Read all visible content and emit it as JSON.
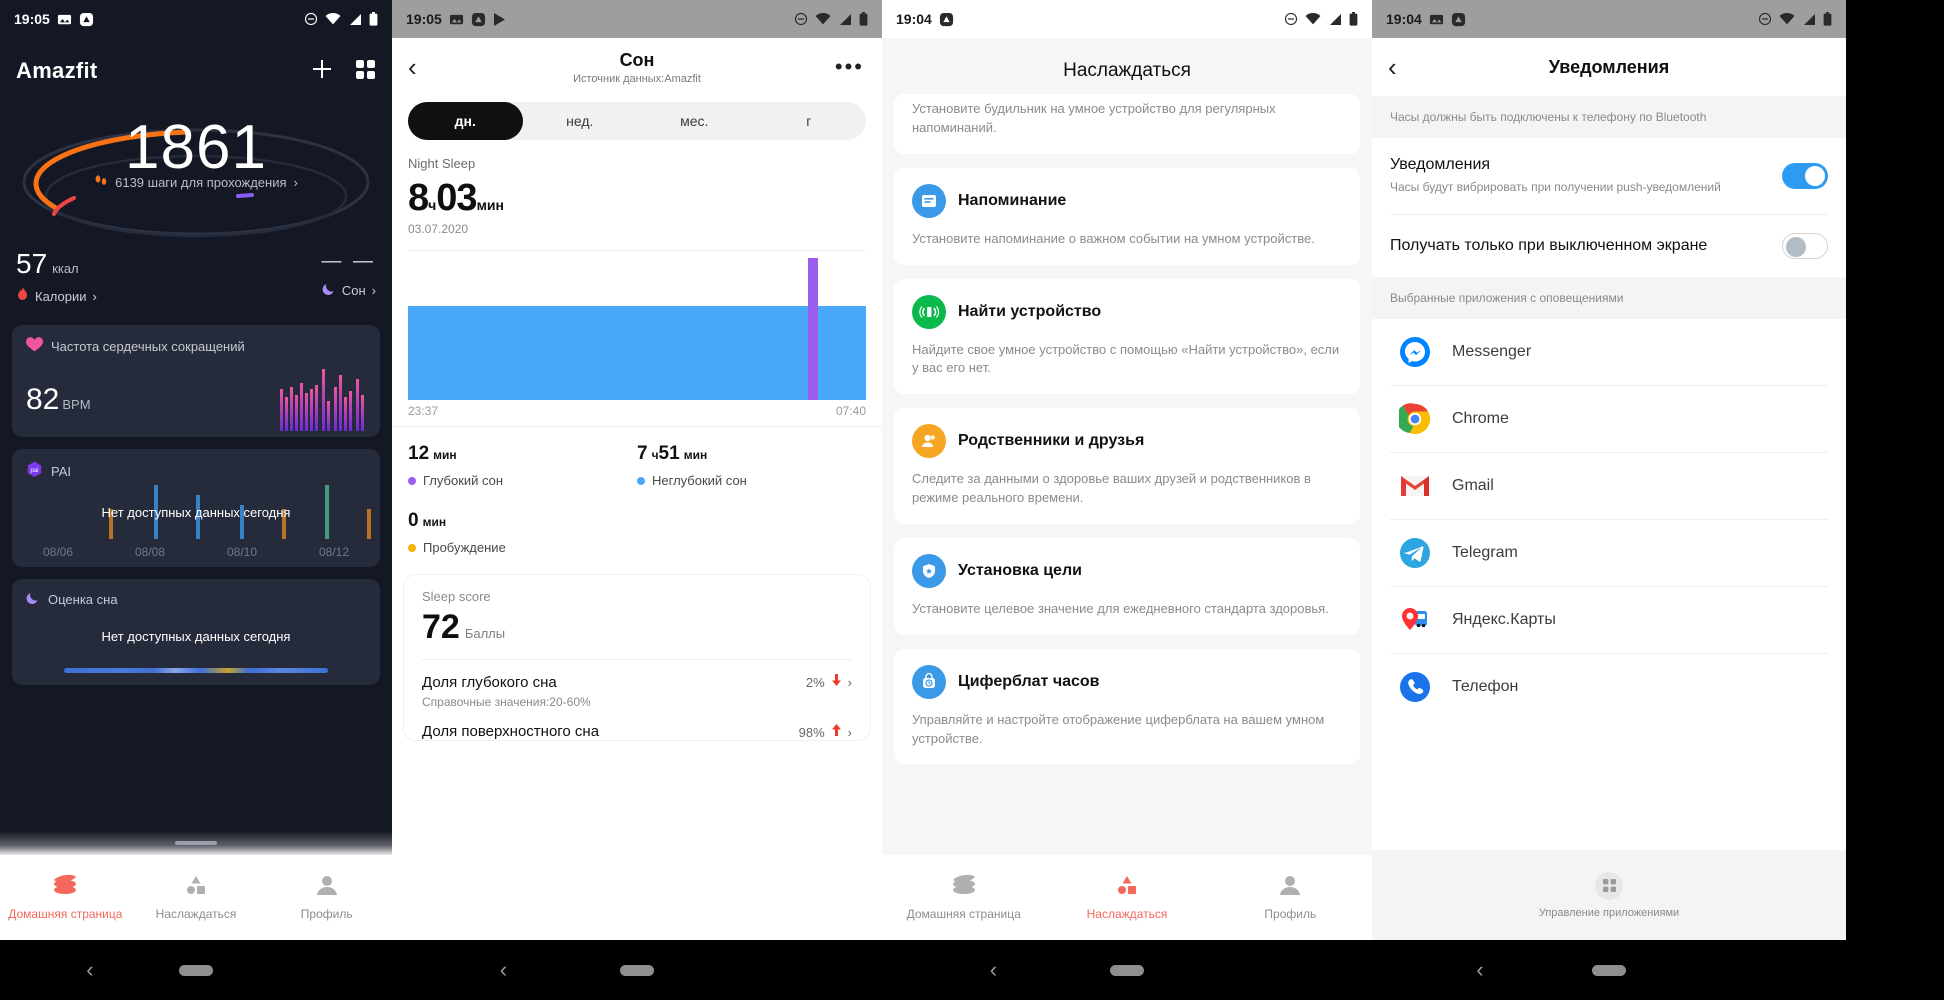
{
  "screen1": {
    "statusbar": {
      "time": "19:05",
      "icons": [
        "image-icon",
        "amazfit-icon",
        "dnd-icon",
        "wifi-icon",
        "signal-icon",
        "battery-icon"
      ]
    },
    "app_title": "Amazfit",
    "actions": {
      "add": "plus-icon",
      "grid": "grid-icon"
    },
    "hero": {
      "steps": "1861",
      "goal_text": "6139 шаги для прохождения",
      "chevron": "›"
    },
    "stats": {
      "calories": {
        "value": "57",
        "unit": "ккал",
        "label": "Калории",
        "chevron": "›"
      },
      "sleep": {
        "value": "— —",
        "label": "Сон",
        "chevron": "›"
      }
    },
    "cards": [
      {
        "title": "Частота сердечных сокращений",
        "value": "82",
        "unit": "BPM",
        "icon": "heart-icon"
      },
      {
        "title": "PAI",
        "empty": "Нет доступных данных сегодня",
        "icon": "pai-icon",
        "dates": [
          "08/06",
          "08/08",
          "08/10",
          "08/12"
        ]
      },
      {
        "title": "Оценка сна",
        "empty": "Нет доступных данных сегодня",
        "icon": "moon-icon"
      }
    ],
    "bottom_nav": [
      {
        "label": "Домашняя страница",
        "icon": "home-stack-icon",
        "active": true
      },
      {
        "label": "Наслаждаться",
        "icon": "shapes-icon",
        "active": false
      },
      {
        "label": "Профиль",
        "icon": "person-icon",
        "active": false
      }
    ]
  },
  "screen2": {
    "statusbar": {
      "time": "19:05",
      "icons": [
        "image-icon",
        "amazfit-icon",
        "play-icon",
        "dnd-icon",
        "wifi-icon",
        "signal-icon",
        "battery-icon"
      ]
    },
    "appbar": {
      "back": "‹",
      "title": "Сон",
      "subtitle": "Источник данных:Amazfit",
      "more": "•••"
    },
    "segments": [
      {
        "label": "дн.",
        "active": true
      },
      {
        "label": "нед.",
        "active": false
      },
      {
        "label": "мес.",
        "active": false
      },
      {
        "label": "г",
        "active": false
      }
    ],
    "summary": {
      "label": "Night Sleep",
      "hours": "8",
      "hours_unit": "ч",
      "minutes": "03",
      "minutes_unit": "мин",
      "date": "03.07.2020"
    },
    "chart_axis": {
      "start": "23:37",
      "end": "07:40"
    },
    "legend": [
      {
        "value": "12",
        "unit": "мин",
        "name": "Глубокий сон",
        "color": "#9b5df0"
      },
      {
        "value": "7",
        "unit_mid": "ч",
        "value2": "51",
        "unit": "мин",
        "name": "Неглубокий сон",
        "color": "#49a9f8"
      },
      {
        "value": "0",
        "unit": "мин",
        "name": "Пробуждение",
        "color": "#f5b207"
      }
    ],
    "score": {
      "label": "Sleep score",
      "value": "72",
      "unit": "Баллы"
    },
    "rows": [
      {
        "title": "Доля глубокого сна",
        "sub": "Справочные значения:20-60%",
        "value": "2%",
        "trend": "down",
        "chevron": "›"
      },
      {
        "title": "Доля поверхностного сна",
        "sub": "",
        "value": "98%",
        "trend": "up",
        "chevron": "›"
      }
    ],
    "chart_data": {
      "type": "bar",
      "title": "Night Sleep 03.07.2020",
      "categories": [
        "23:37",
        "07:40"
      ],
      "series": [
        {
          "name": "Неглубокий сон",
          "color": "#49a9f8",
          "value_minutes": 471
        },
        {
          "name": "Глубокий сон",
          "color": "#9b5df0",
          "value_minutes": 12
        },
        {
          "name": "Пробуждение",
          "color": "#f5b207",
          "value_minutes": 0
        }
      ],
      "xlabel": "",
      "ylabel": "",
      "grid": true,
      "annotations": [
        "Deep-sleep segment near 07:05",
        "Total 8ч 03мин"
      ]
    }
  },
  "screen3": {
    "statusbar": {
      "time": "19:04",
      "icons": [
        "amazfit-icon",
        "dnd-icon",
        "wifi-icon",
        "signal-icon",
        "battery-icon"
      ]
    },
    "title": "Наслаждаться",
    "partial_card_desc": "Установите будильник на умное устройство для регулярных напоминаний.",
    "cards": [
      {
        "title": "Напоминание",
        "desc": "Установите напоминание о важном событии на умном устройстве.",
        "icon": "note-icon",
        "color": "#3a9ae8"
      },
      {
        "title": "Найти устройство",
        "desc": "Найдите свое умное устройство с помощью «Найти устройство», если у вас его нет.",
        "icon": "find-device-icon",
        "color": "#0ab84b"
      },
      {
        "title": "Родственники и друзья",
        "desc": "Следите за данными о здоровье ваших друзей и родственников в режиме реального времени.",
        "icon": "people-icon",
        "color": "#f5a623"
      },
      {
        "title": "Установка цели",
        "desc": "Установите целевое значение для ежедневного стандарта здоровья.",
        "icon": "shield-icon",
        "color": "#3a9ae8"
      },
      {
        "title": "Циферблат часов",
        "desc": "Управляйте и настройте отображение циферблата на вашем умном устройстве.",
        "icon": "watchface-icon",
        "color": "#3a9ae8"
      }
    ],
    "bottom_nav": [
      {
        "label": "Домашняя страница",
        "icon": "home-stack-icon",
        "active": false
      },
      {
        "label": "Наслаждаться",
        "icon": "shapes-icon",
        "active": true
      },
      {
        "label": "Профиль",
        "icon": "person-icon",
        "active": false
      }
    ]
  },
  "screen4": {
    "statusbar": {
      "time": "19:04",
      "icons": [
        "image-icon",
        "amazfit-icon",
        "dnd-icon",
        "wifi-icon",
        "signal-icon",
        "battery-icon"
      ]
    },
    "appbar": {
      "back": "‹",
      "title": "Уведомления"
    },
    "hint": "Часы должны быть подключены к телефону по Bluetooth",
    "settings": [
      {
        "title": "Уведомления",
        "sub": "Часы будут вибрировать при получении push-уведомлений",
        "toggle": "on"
      },
      {
        "title": "Получать только при выключенном экране",
        "sub": "",
        "toggle": "off"
      }
    ],
    "apps_section": "Выбранные приложения с оповещениями",
    "apps": [
      {
        "name": "Messenger",
        "icon": "messenger-icon"
      },
      {
        "name": "Chrome",
        "icon": "chrome-icon"
      },
      {
        "name": "Gmail",
        "icon": "gmail-icon"
      },
      {
        "name": "Telegram",
        "icon": "telegram-icon"
      },
      {
        "name": "Яндекс.Карты",
        "icon": "yandex-maps-icon"
      },
      {
        "name": "Телефон",
        "icon": "phone-icon"
      }
    ],
    "manage": {
      "label": "Управление приложениями",
      "icon": "apps-grid-icon"
    }
  },
  "colors": {
    "accent_red": "#f4685e",
    "light_sleep": "#49a9f8",
    "deep_sleep": "#9b5df0",
    "awake": "#f5b207",
    "toggle_on": "#2d9bf0"
  }
}
